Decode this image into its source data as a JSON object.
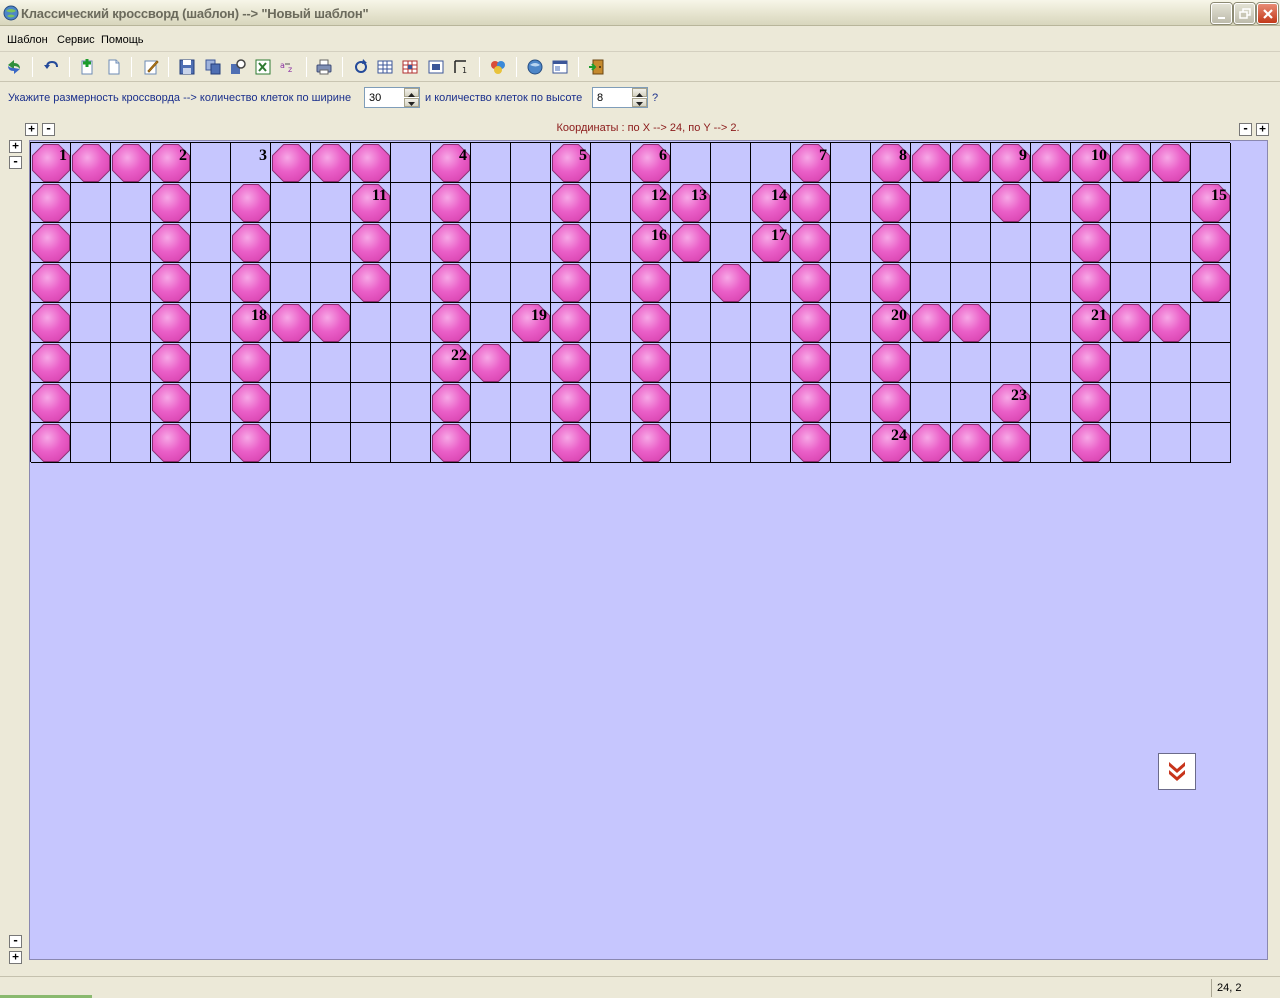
{
  "window": {
    "title": "Классический кроссворд (шаблон) --> \"Новый шаблон\"",
    "icons": {
      "minimize": "minimize-icon",
      "maximize": "restore-icon",
      "close": "close-icon"
    }
  },
  "menu": {
    "items": [
      "Шаблон",
      "Сервис",
      "Помощь"
    ]
  },
  "toolbar": {
    "buttons": [
      "refresh-arrows-icon",
      "undo-icon",
      "add-icon",
      "new-document-icon",
      "edit-icon",
      "save-icon",
      "copy-icon",
      "find-icon",
      "export-excel-icon",
      "sort-az-icon",
      "print-icon",
      "redo-icon",
      "grid-icon",
      "grid-color-icon",
      "grid-zoom-icon",
      "grid-corner-icon",
      "palette-icon",
      "globe-icon",
      "window-icon",
      "exit-door-icon"
    ]
  },
  "size": {
    "label_width": "Укажите размерность кроссворда --> количество клеток по ширине",
    "width_value": "30",
    "label_height": "и количество клеток по высоте",
    "height_value": "8",
    "question": "?"
  },
  "coords_text": "Координаты : по X --> 24, по Y --> 2.",
  "zoom": {
    "plus": "+",
    "minus": "-"
  },
  "grid": {
    "cols": 30,
    "rows": 8,
    "filled": [
      [
        0,
        1,
        2,
        3,
        6,
        7,
        8,
        10,
        13,
        15,
        19,
        21,
        22,
        23,
        24,
        25,
        26,
        27,
        28
      ],
      [
        0,
        3,
        5,
        8,
        10,
        13,
        15,
        16,
        18,
        19,
        21,
        24,
        26,
        29
      ],
      [
        0,
        3,
        5,
        8,
        10,
        13,
        15,
        16,
        18,
        19,
        21,
        26,
        29
      ],
      [
        0,
        3,
        5,
        8,
        10,
        13,
        15,
        17,
        19,
        21,
        26,
        29
      ],
      [
        0,
        3,
        5,
        6,
        7,
        10,
        12,
        13,
        15,
        19,
        21,
        22,
        23,
        26,
        27,
        28
      ],
      [
        0,
        3,
        5,
        10,
        11,
        13,
        15,
        19,
        21,
        26
      ],
      [
        0,
        3,
        5,
        10,
        13,
        15,
        19,
        21,
        24,
        26
      ],
      [
        0,
        3,
        5,
        10,
        13,
        15,
        19,
        21,
        22,
        23,
        24,
        26
      ]
    ],
    "numbers": [
      {
        "n": "1",
        "r": 0,
        "c": 0
      },
      {
        "n": "2",
        "r": 0,
        "c": 3
      },
      {
        "n": "3",
        "r": 0,
        "c": 5
      },
      {
        "n": "4",
        "r": 0,
        "c": 10
      },
      {
        "n": "5",
        "r": 0,
        "c": 13
      },
      {
        "n": "6",
        "r": 0,
        "c": 15
      },
      {
        "n": "7",
        "r": 0,
        "c": 19
      },
      {
        "n": "8",
        "r": 0,
        "c": 21
      },
      {
        "n": "9",
        "r": 0,
        "c": 24
      },
      {
        "n": "10",
        "r": 0,
        "c": 26
      },
      {
        "n": "11",
        "r": 1,
        "c": 8
      },
      {
        "n": "12",
        "r": 1,
        "c": 15
      },
      {
        "n": "13",
        "r": 1,
        "c": 16
      },
      {
        "n": "14",
        "r": 1,
        "c": 18
      },
      {
        "n": "15",
        "r": 1,
        "c": 29
      },
      {
        "n": "16",
        "r": 2,
        "c": 15
      },
      {
        "n": "17",
        "r": 2,
        "c": 18
      },
      {
        "n": "18",
        "r": 4,
        "c": 5
      },
      {
        "n": "19",
        "r": 4,
        "c": 12
      },
      {
        "n": "20",
        "r": 4,
        "c": 21
      },
      {
        "n": "21",
        "r": 4,
        "c": 26
      },
      {
        "n": "22",
        "r": 5,
        "c": 10
      },
      {
        "n": "23",
        "r": 6,
        "c": 24
      },
      {
        "n": "24",
        "r": 7,
        "c": 21
      }
    ]
  },
  "scroll_button_icon": "double-chevron-down-icon",
  "status": {
    "coords": "24, 2"
  }
}
